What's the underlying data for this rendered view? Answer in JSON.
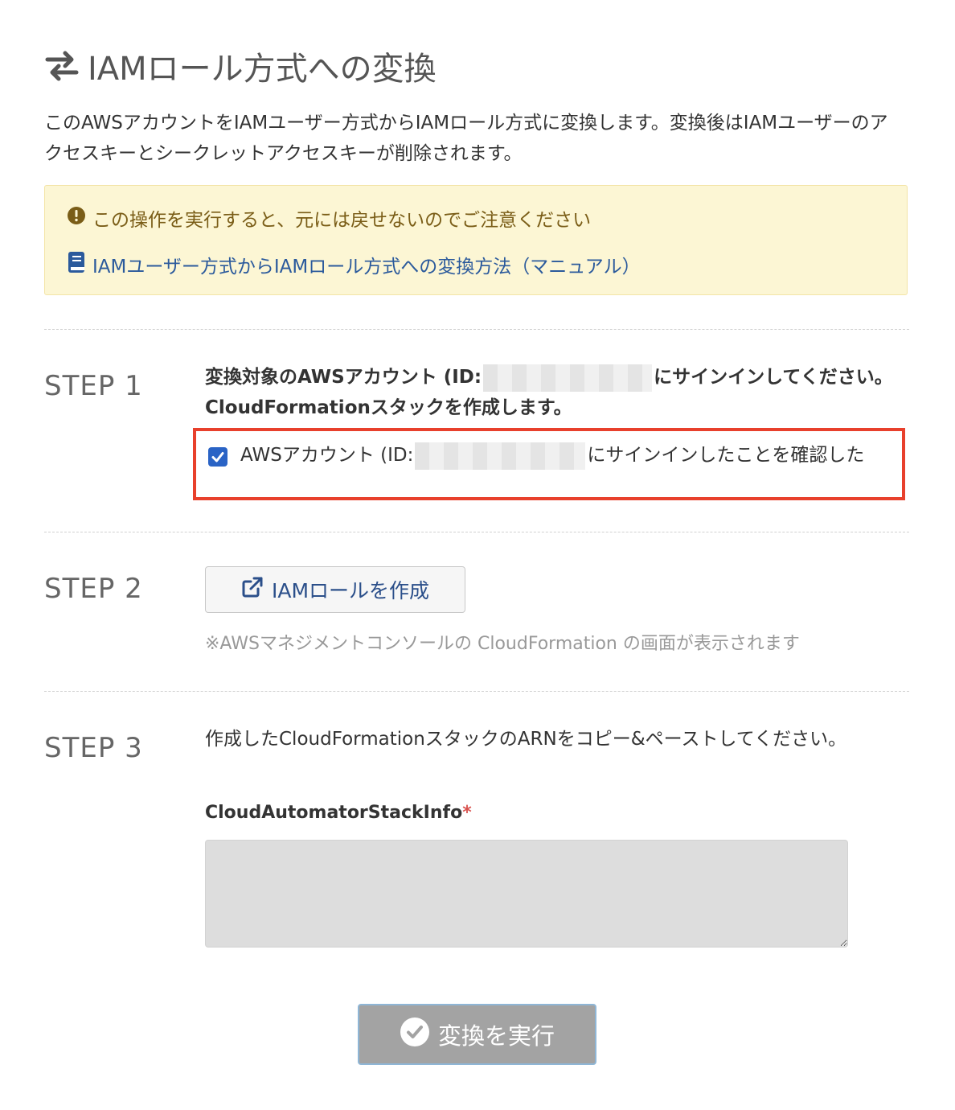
{
  "header": {
    "icon": "swap-arrows-icon",
    "title": "IAMロール方式への変換"
  },
  "intro": "このAWSアカウントをIAMユーザー方式からIAMロール方式に変換します。変換後はIAMユーザーのアクセスキーとシークレットアクセスキーが削除されます。",
  "alert": {
    "icon": "exclamation-circle-icon",
    "warning": "この操作を実行すると、元には戻せないのでご注意ください",
    "manual_icon": "book-icon",
    "manual_link": "IAMユーザー方式からIAMロール方式への変換方法（マニュアル）",
    "background_color": "#fcf6d4"
  },
  "steps": [
    {
      "label": "STEP 1",
      "text_before": "変換対象のAWSアカウント (ID:",
      "text_after": "にサインインしてください。CloudFormationスタックを作成します。",
      "confirm": {
        "checked": true,
        "text_before": "AWSアカウント (ID:",
        "text_after": "にサインインしたことを確認した"
      }
    },
    {
      "label": "STEP 2",
      "button_icon": "external-link-icon",
      "button_label": "IAMロールを作成",
      "note": "※AWSマネジメントコンソールの CloudFormation の画面が表示されます"
    },
    {
      "label": "STEP 3",
      "text": "作成したCloudFormationスタックのARNをコピー&ペーストしてください。",
      "field_label": "CloudAutomatorStackInfo",
      "required_mark": "*",
      "field_value": ""
    }
  ],
  "submit": {
    "icon": "check-circle-icon",
    "label": "変換を実行"
  },
  "colors": {
    "highlight_border": "#e8402c",
    "link": "#2b5a9c",
    "checkbox": "#2a63c5"
  }
}
